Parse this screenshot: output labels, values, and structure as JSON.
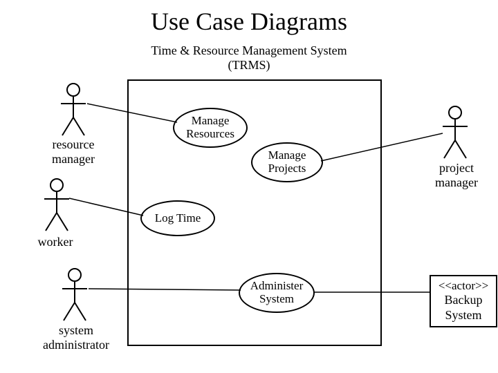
{
  "title": "Use Case Diagrams",
  "subtitle_line1": "Time & Resource Management System",
  "subtitle_line2": "(TRMS)",
  "actors": {
    "resource_manager": "resource\nmanager",
    "worker": "worker",
    "system_administrator": "system\nadministrator",
    "project_manager": "project\nmanager",
    "backup_stereotype": "<<actor>>",
    "backup_name": "Backup\nSystem"
  },
  "usecases": {
    "manage_resources": "Manage\nResources",
    "manage_projects": "Manage\nProjects",
    "log_time": "Log Time",
    "administer_system": "Administer\nSystem"
  }
}
